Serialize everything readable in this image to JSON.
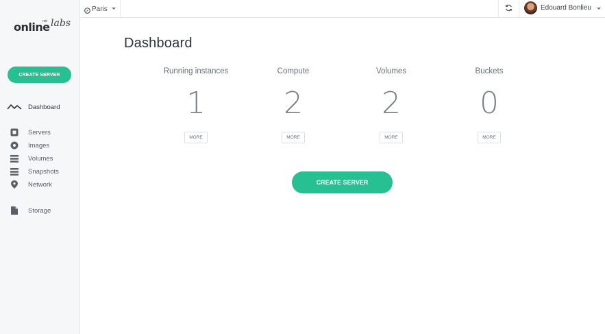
{
  "brand": {
    "name": "online",
    "suffix": "labs",
    "net": "net"
  },
  "sidebar": {
    "cta_label": "CREATE SERVER",
    "items": [
      {
        "label": "Dashboard",
        "icon": "activity-icon"
      },
      {
        "label": "Servers",
        "icon": "server-icon"
      },
      {
        "label": "Images",
        "icon": "disc-icon"
      },
      {
        "label": "Volumes",
        "icon": "stack-icon"
      },
      {
        "label": "Snapshots",
        "icon": "stack-icon"
      },
      {
        "label": "Network",
        "icon": "location-pin-icon"
      },
      {
        "label": "Storage",
        "icon": "file-icon"
      }
    ]
  },
  "topbar": {
    "region": "Paris",
    "user_name": "Edouard Bonlieu"
  },
  "main": {
    "title": "Dashboard",
    "stats": [
      {
        "label": "Running instances",
        "value": "1",
        "more": "MORE"
      },
      {
        "label": "Compute",
        "value": "2",
        "more": "MORE"
      },
      {
        "label": "Volumes",
        "value": "2",
        "more": "MORE"
      },
      {
        "label": "Buckets",
        "value": "0",
        "more": "MORE"
      }
    ],
    "cta_label": "CREATE SERVER"
  },
  "colors": {
    "accent": "#26c093",
    "sidebar_bg": "#f6f7f8"
  }
}
